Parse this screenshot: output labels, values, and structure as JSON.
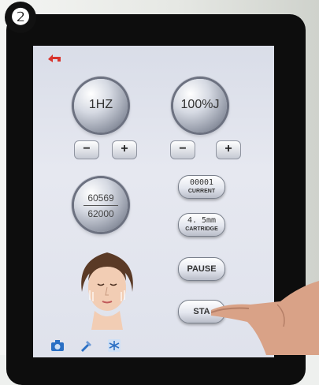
{
  "badge": "❷",
  "knobs": {
    "frequency": "1HZ",
    "energy": "100%J",
    "count_top": "60569",
    "count_bottom": "62000"
  },
  "steppers": {
    "minus": "−",
    "plus": "+"
  },
  "pills": {
    "current_value": "00001",
    "current_label": "CURRENT",
    "cartridge_value": "4. 5mm",
    "cartridge_label": "CARTRIDGE",
    "pause": "PAUSE",
    "start": "STA"
  },
  "icons": [
    "back-arrow-icon",
    "camera-icon",
    "tool-icon",
    "snowflake-icon"
  ],
  "colors": {
    "accent_red": "#d8342c",
    "icon_blue": "#2a6fc4",
    "bezel": "#0d0d0d"
  }
}
